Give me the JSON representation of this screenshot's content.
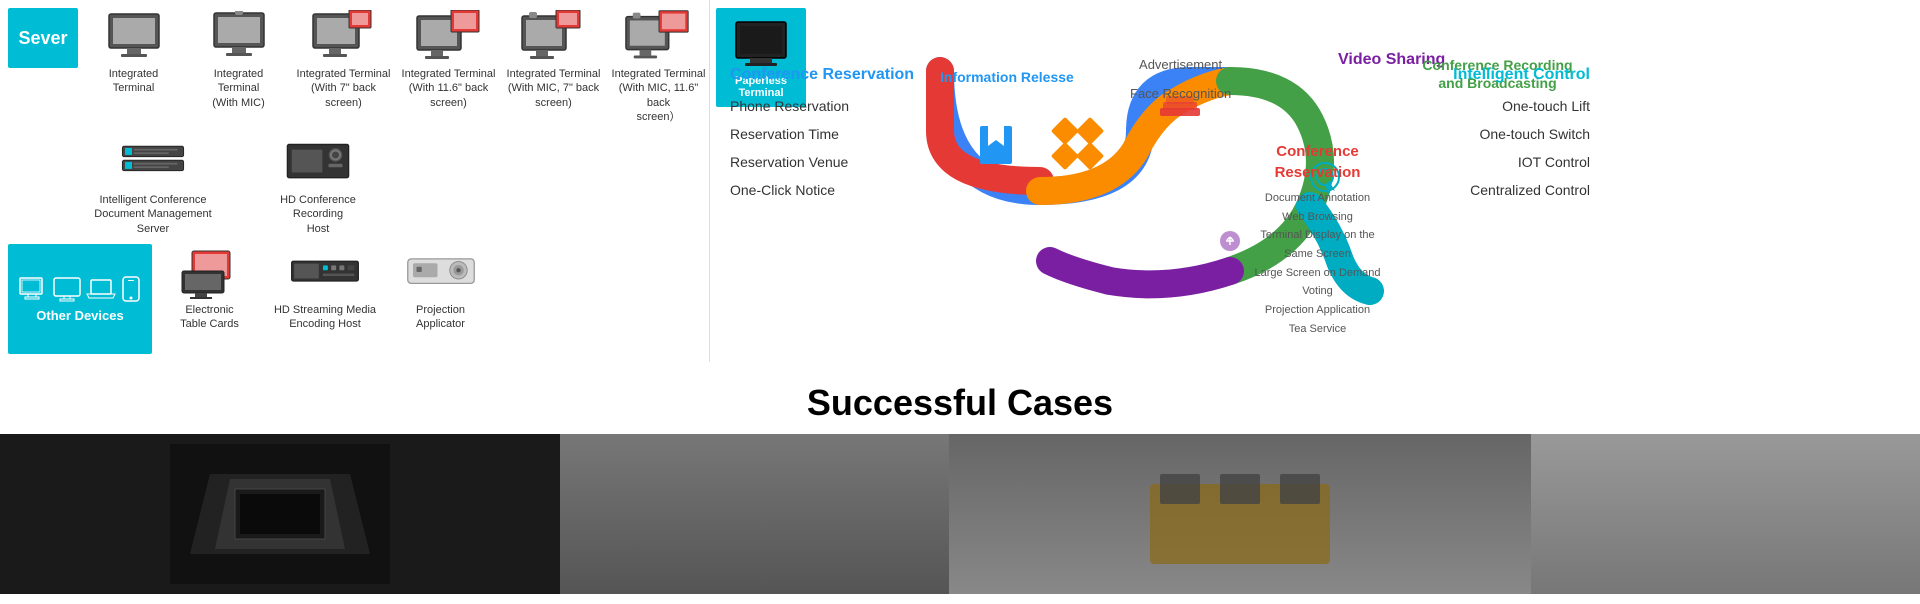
{
  "header": {
    "server_label": "Sever"
  },
  "devices": {
    "server_row": [
      {
        "label": "Intelligent Conference\nDocument Management\nServer",
        "icon_type": "server"
      },
      {
        "label": "HD Conference Recording\nHost",
        "icon_type": "recording-host"
      }
    ],
    "terminal_row": [
      {
        "label": "Integrated\nTerminal",
        "icon_type": "monitor-flat"
      },
      {
        "label": "Integrated\nTerminal\n(With MIC)",
        "icon_type": "monitor-mic"
      },
      {
        "label": "Integrated Terminal\n(With 7\" back\nscreen)",
        "icon_type": "monitor-back"
      },
      {
        "label": "Integrated Terminal\n(With 11.6\" back\nscreen)",
        "icon_type": "monitor-back2"
      },
      {
        "label": "Integrated Terminal\n(With MIC, 7\" back\nscreen)",
        "icon_type": "monitor-mic-back"
      },
      {
        "label": "Integrated Terminal\n(With MIC, 11.6\" back\nscreen）",
        "icon_type": "monitor-mic-back2"
      },
      {
        "label": "Paperless\nTerminal",
        "icon_type": "paperless",
        "highlighted": true
      }
    ],
    "other_devices": {
      "label": "Other Devices"
    },
    "other_row": [
      {
        "label": "Electronic\nTable Cards",
        "icon_type": "table-card"
      },
      {
        "label": "HD Streaming Media\nEncoding Host",
        "icon_type": "encoder"
      },
      {
        "label": "Projection\nApplicator",
        "icon_type": "projector"
      }
    ]
  },
  "diagram": {
    "conf_reservation": {
      "title": "Conference Reservation",
      "items": [
        "Phone Reservation",
        "Reservation Time",
        "Reservation Venue",
        "One-Click Notice"
      ]
    },
    "info_release": {
      "title": "Information Relesse"
    },
    "center_reservation": {
      "title": "Conference\nReservation"
    },
    "advert_face": {
      "advertisement": "Advertisement",
      "face_recognition": "Face Recognition"
    },
    "video_sharing": {
      "title": "Video Sharing"
    },
    "conf_recording": {
      "title": "Conference Recording\nand Broadcasting",
      "items": [
        "Document Annotation",
        "Web Browsing",
        "Terminal Display on the Same Screen",
        "Large Screen on Demand",
        "Voting",
        "Projection Application",
        "Tea Service"
      ]
    },
    "intelligent_control": {
      "title": "Intelligent Control",
      "items": [
        "One-touch Lift",
        "One-touch Switch",
        "IOT Control",
        "Centralized Control"
      ]
    }
  },
  "cases": {
    "title": "Successful Cases"
  },
  "colors": {
    "teal": "#00bcd4",
    "blue": "#2196f3",
    "red": "#e53935",
    "orange": "#fb8c00",
    "green": "#43a047",
    "purple": "#7b1fa2",
    "cyan": "#00acc1"
  }
}
